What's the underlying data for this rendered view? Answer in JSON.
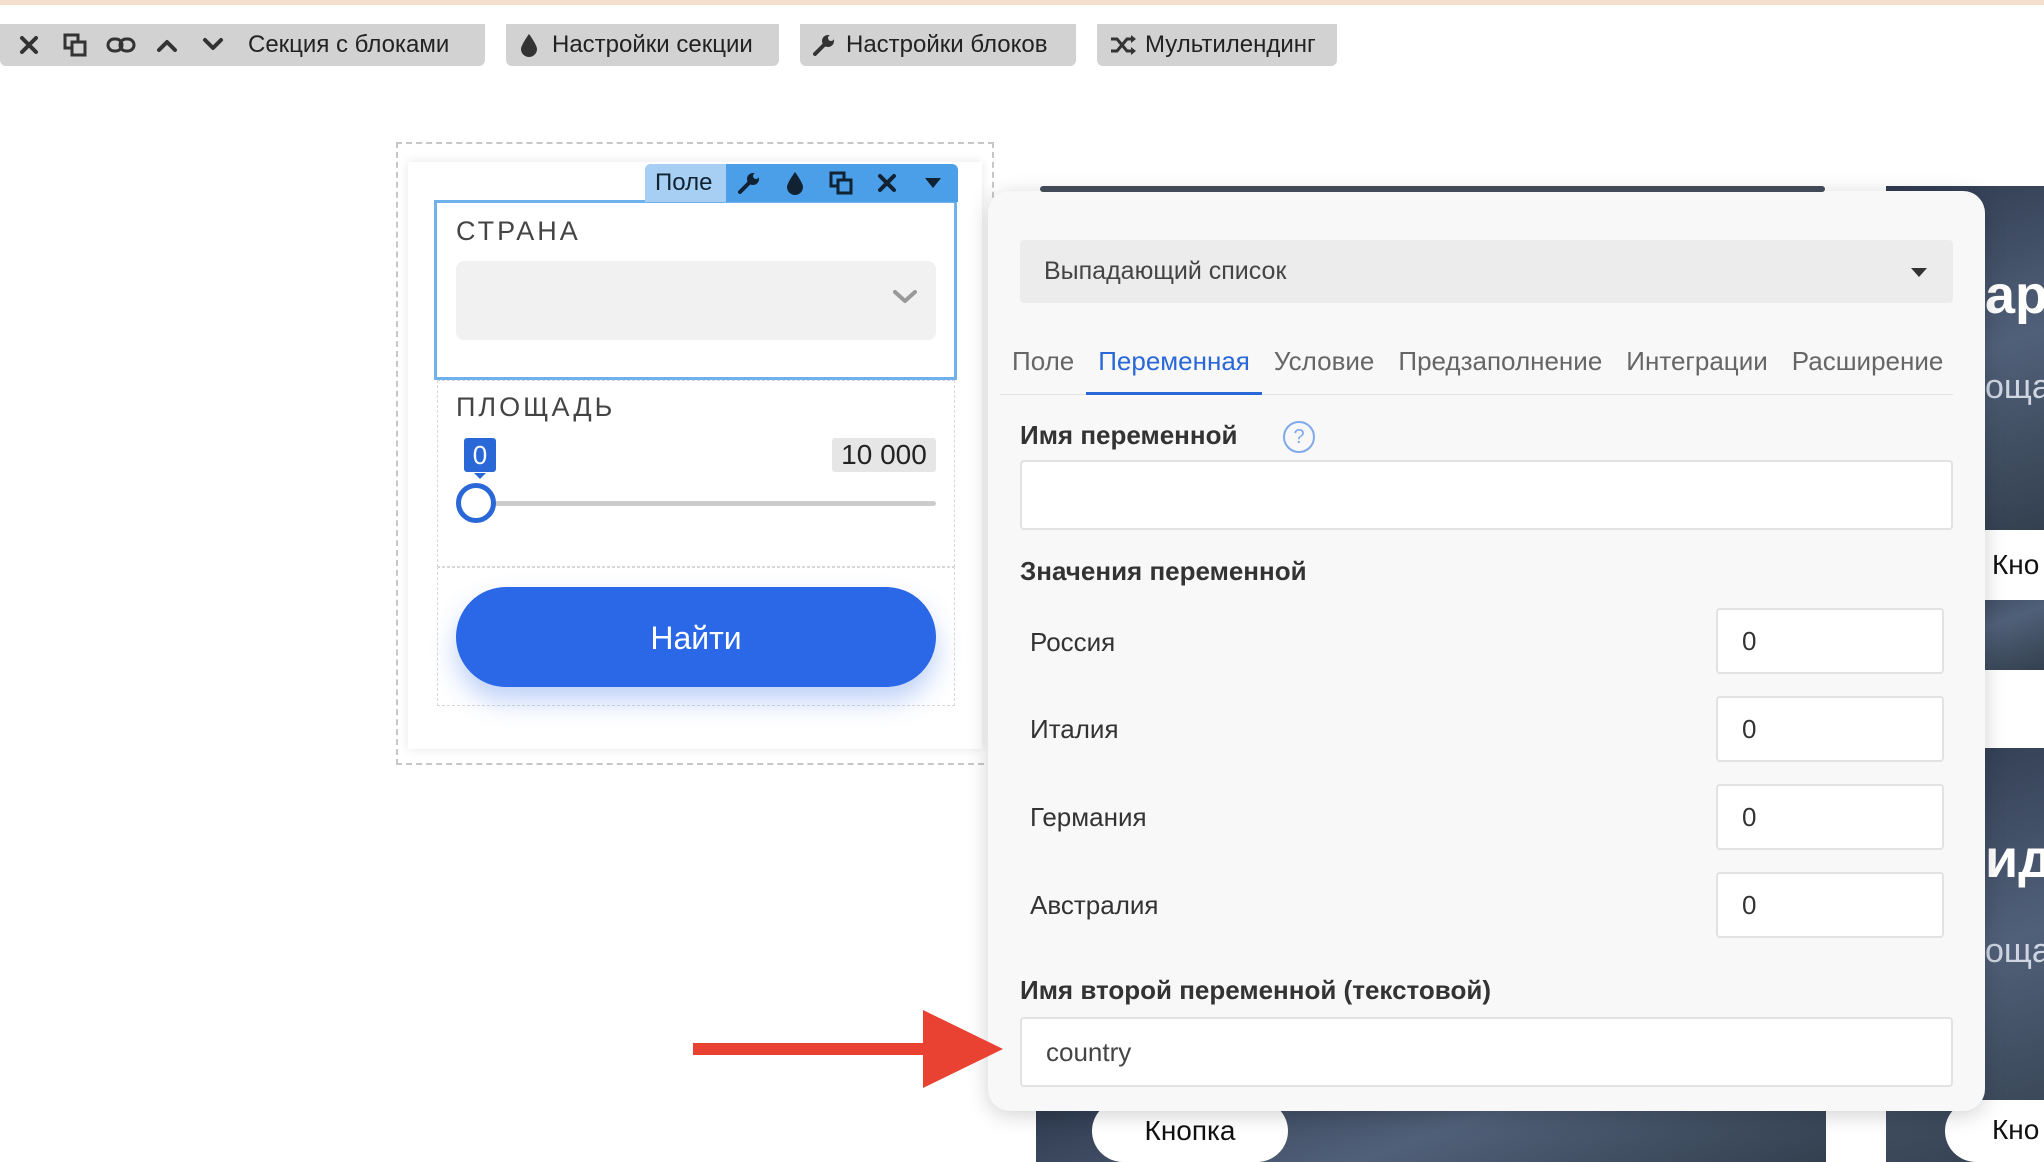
{
  "toolbar": {
    "section_label": "Секция с блоками",
    "section_settings_label": "Настройки секции",
    "block_settings_label": "Настройки блоков",
    "multilanding_label": "Мультилендинг"
  },
  "form": {
    "field_toolbar_name": "Поле",
    "country_title": "СТРАНА",
    "area_title": "ПЛОЩАДЬ",
    "range_min": "0",
    "range_max": "10 000",
    "range_level_fraction": 0,
    "submit_label": "Найти"
  },
  "background": {
    "edge_text_1": "ар",
    "edge_sub_1": "оща",
    "edge_button_1": "Кно",
    "edge_text_2": "ид",
    "edge_sub_2": "оща",
    "edge_button_2": "Кно",
    "bottom_button": "Кнопка"
  },
  "panel": {
    "field_type": "Выпадающий список",
    "tabs": [
      "Поле",
      "Переменная",
      "Условие",
      "Предзаполнение",
      "Интеграции",
      "Расширение"
    ],
    "active_tab": "Переменная",
    "variable_name_label": "Имя переменной",
    "variable_name_value": "",
    "help_glyph": "?",
    "variable_values_label": "Значения переменной",
    "variable_values": [
      {
        "name": "Россия",
        "value": "0"
      },
      {
        "name": "Италия",
        "value": "0"
      },
      {
        "name": "Германия",
        "value": "0"
      },
      {
        "name": "Австралия",
        "value": "0"
      }
    ],
    "second_variable_label": "Имя второй переменной (текстовой)",
    "second_variable_value": "country"
  },
  "colors": {
    "accent": "#2a68d8",
    "button": "#2a68e8",
    "field_toolbar": "#4a9fe8",
    "annotation_arrow": "#e94132"
  }
}
